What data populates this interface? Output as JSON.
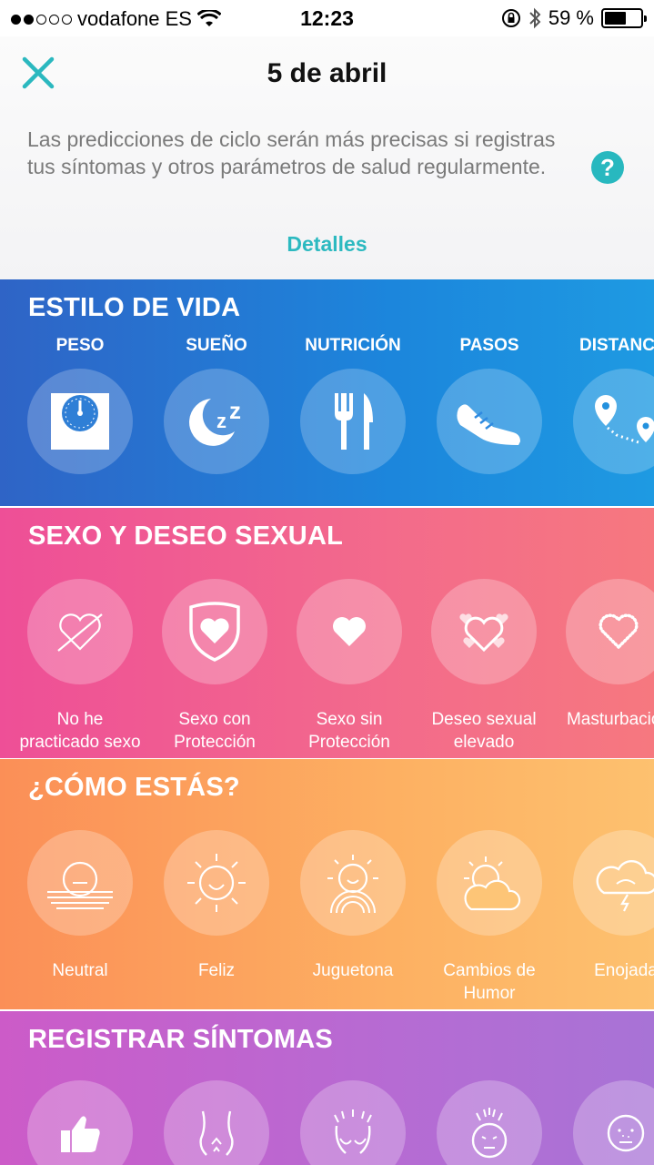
{
  "status_bar": {
    "carrier": "vodafone ES",
    "time": "12:23",
    "battery": "59 %",
    "battery_level": 0.59
  },
  "header": {
    "title": "5 de abril",
    "info": "Las predicciones de ciclo serán más precisas si registras tus síntomas y otros parámetros de salud regularmente.",
    "help": "?",
    "details": "Detalles"
  },
  "lifestyle": {
    "title": "ESTILO DE VIDA",
    "items": [
      {
        "label": "PESO",
        "icon": "scale-icon"
      },
      {
        "label": "SUEÑO",
        "icon": "moon-sleep-icon"
      },
      {
        "label": "NUTRICIÓN",
        "icon": "fork-knife-icon"
      },
      {
        "label": "PASOS",
        "icon": "sneaker-icon"
      },
      {
        "label": "DISTANCIA",
        "icon": "map-pin-route-icon"
      }
    ]
  },
  "sex": {
    "title": "SEXO Y DESEO SEXUAL",
    "items": [
      {
        "line1": "No he",
        "line2": "practicado sexo",
        "icon": "crossed-heart-icon"
      },
      {
        "line1": "Sexo con",
        "line2": "Protección",
        "icon": "shield-heart-icon"
      },
      {
        "line1": "Sexo sin",
        "line2": "Protección",
        "icon": "heart-icon"
      },
      {
        "line1": "Deseo sexual",
        "line2": "elevado",
        "icon": "hearts-icon"
      },
      {
        "line1": "Masturbación",
        "line2": "",
        "icon": "dotted-heart-icon"
      }
    ]
  },
  "mood": {
    "title": "¿CÓMO ESTÁS?",
    "items": [
      {
        "line1": "Neutral",
        "line2": "",
        "icon": "neutral-sun-icon"
      },
      {
        "line1": "Feliz",
        "line2": "",
        "icon": "happy-sun-icon"
      },
      {
        "line1": "Juguetona",
        "line2": "",
        "icon": "playful-sun-icon"
      },
      {
        "line1": "Cambios de",
        "line2": "Humor",
        "icon": "sun-cloud-icon"
      },
      {
        "line1": "Enojada",
        "line2": "",
        "icon": "storm-cloud-icon"
      }
    ]
  },
  "symptoms": {
    "title": "REGISTRAR SÍNTOMAS",
    "items": [
      {
        "icon": "thumbs-up-icon"
      },
      {
        "icon": "cramps-icon"
      },
      {
        "icon": "breast-tenderness-icon"
      },
      {
        "icon": "headache-icon"
      },
      {
        "icon": "acne-icon"
      }
    ]
  }
}
